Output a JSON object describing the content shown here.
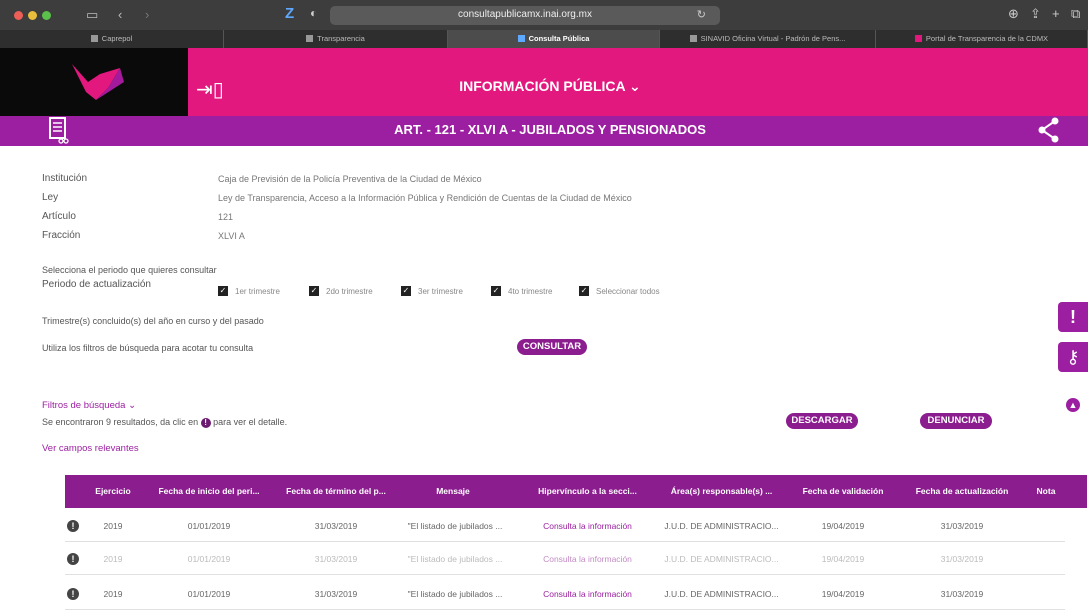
{
  "browser": {
    "url": "consultapublicamx.inai.org.mx",
    "tabs": [
      {
        "label": "Caprepol",
        "active": false
      },
      {
        "label": "Transparencia",
        "active": false
      },
      {
        "label": "Consulta Pública",
        "active": true
      },
      {
        "label": "SINAVID Oficina Virtual - Padrón de Pens...",
        "active": false
      },
      {
        "label": "Portal de Transparencia de la CDMX",
        "active": false
      }
    ]
  },
  "header": {
    "title": "INFORMACIÓN PÚBLICA ⌄",
    "subtitle": "ART. - 121 - XLVI A - JUBILADOS Y PENSIONADOS"
  },
  "meta": {
    "institucion_label": "Institución",
    "institucion_value": "Caja de Previsión de la Policía Preventiva de la Ciudad de México",
    "ley_label": "Ley",
    "ley_value": "Ley de Transparencia, Acceso a la Información Pública y Rendición de Cuentas de la Ciudad de México",
    "articulo_label": "Artículo",
    "articulo_value": "121",
    "fraccion_label": "Fracción",
    "fraccion_value": "XLVI A"
  },
  "period": {
    "prompt": "Selecciona el periodo que quieres consultar",
    "label": "Periodo de actualización",
    "options": [
      "1er trimestre",
      "2do trimestre",
      "3er trimestre",
      "4to trimestre",
      "Seleccionar todos"
    ],
    "note": "Trimestre(s) concluido(s) del año en curso y del pasado"
  },
  "search": {
    "hint": "Utiliza los filtros de búsqueda para acotar tu consulta",
    "consultar": "CONSULTAR",
    "filters": "Filtros de búsqueda ⌄"
  },
  "results": {
    "prefix": "Se encontraron 9 resultados, da clic en",
    "suffix": "para ver el detalle.",
    "descargar": "DESCARGAR",
    "denunciar": "DENUNCIAR",
    "relevant": "Ver campos relevantes"
  },
  "table": {
    "headers": [
      "Ejercicio",
      "Fecha de inicio del peri...",
      "Fecha de término del p...",
      "Mensaje",
      "Hipervínculo a la secci...",
      "Área(s) responsable(s) ...",
      "Fecha de validación",
      "Fecha de actualización",
      "Nota"
    ],
    "rows": [
      {
        "ejercicio": "2019",
        "inicio": "01/01/2019",
        "termino": "31/03/2019",
        "mensaje": "\"El listado de jubilados ...",
        "hipervinculo": "Consulta la información",
        "area": "J.U.D. DE ADMINISTRACIO...",
        "validacion": "19/04/2019",
        "actualizacion": "31/03/2019",
        "faded": false
      },
      {
        "ejercicio": "2019",
        "inicio": "01/01/2019",
        "termino": "31/03/2019",
        "mensaje": "\"El listado de jubilados ...",
        "hipervinculo": "Consulta la información",
        "area": "J.U.D. DE ADMINISTRACIO...",
        "validacion": "19/04/2019",
        "actualizacion": "31/03/2019",
        "faded": true
      },
      {
        "ejercicio": "2019",
        "inicio": "01/01/2019",
        "termino": "31/03/2019",
        "mensaje": "\"El listado de jubilados ...",
        "hipervinculo": "Consulta la información",
        "area": "J.U.D. DE ADMINISTRACIO...",
        "validacion": "19/04/2019",
        "actualizacion": "31/03/2019",
        "faded": false
      }
    ]
  },
  "colors": {
    "magenta": "#e3187f",
    "purple": "#9c1fa1",
    "dark_purple": "#8b1d8f"
  }
}
